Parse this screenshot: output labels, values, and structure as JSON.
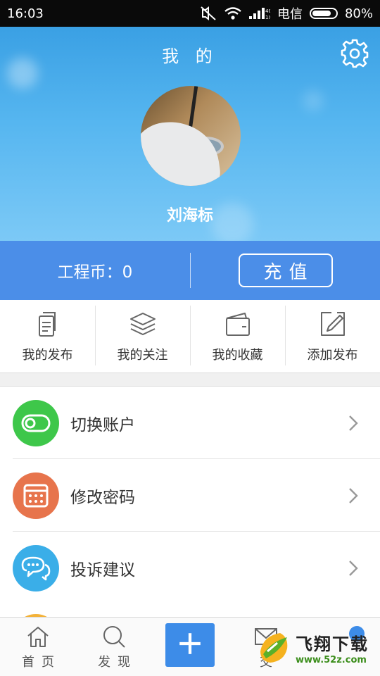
{
  "status_bar": {
    "time": "16:03",
    "network": "4G\n1X",
    "carrier": "电信",
    "battery_percent": "80%",
    "battery_level": 0.8
  },
  "header": {
    "title": "我 的",
    "settings_icon": "gear-icon",
    "username": "刘海标"
  },
  "coin_bar": {
    "coin_text": "工程币：0",
    "recharge_label": "充值"
  },
  "quick_actions": [
    {
      "label": "我的发布",
      "icon": "document-icon"
    },
    {
      "label": "我的关注",
      "icon": "layers-icon"
    },
    {
      "label": "我的收藏",
      "icon": "wallet-icon"
    },
    {
      "label": "添加发布",
      "icon": "edit-icon"
    }
  ],
  "settings_list": [
    {
      "label": "切换账户",
      "icon": "toggle-icon",
      "color": "#3ec74a"
    },
    {
      "label": "修改密码",
      "icon": "keypad-icon",
      "color": "#e7744c"
    },
    {
      "label": "投诉建议",
      "icon": "chat-bubbles-icon",
      "color": "#3aaee8"
    }
  ],
  "tab_bar": [
    {
      "label": "首页",
      "icon": "home-icon"
    },
    {
      "label": "发现",
      "icon": "search-icon"
    },
    {
      "label": "",
      "icon": "plus-icon"
    },
    {
      "label": "交",
      "icon": "mail-icon"
    },
    {
      "label": "",
      "icon": "user-icon"
    }
  ],
  "watermark": {
    "brand": "飞翔下载",
    "site": "www.52z.com"
  },
  "colors": {
    "header_blue": "#4ea9ee",
    "coin_bar": "#4b8ee8",
    "accent": "#3d8ce8"
  }
}
